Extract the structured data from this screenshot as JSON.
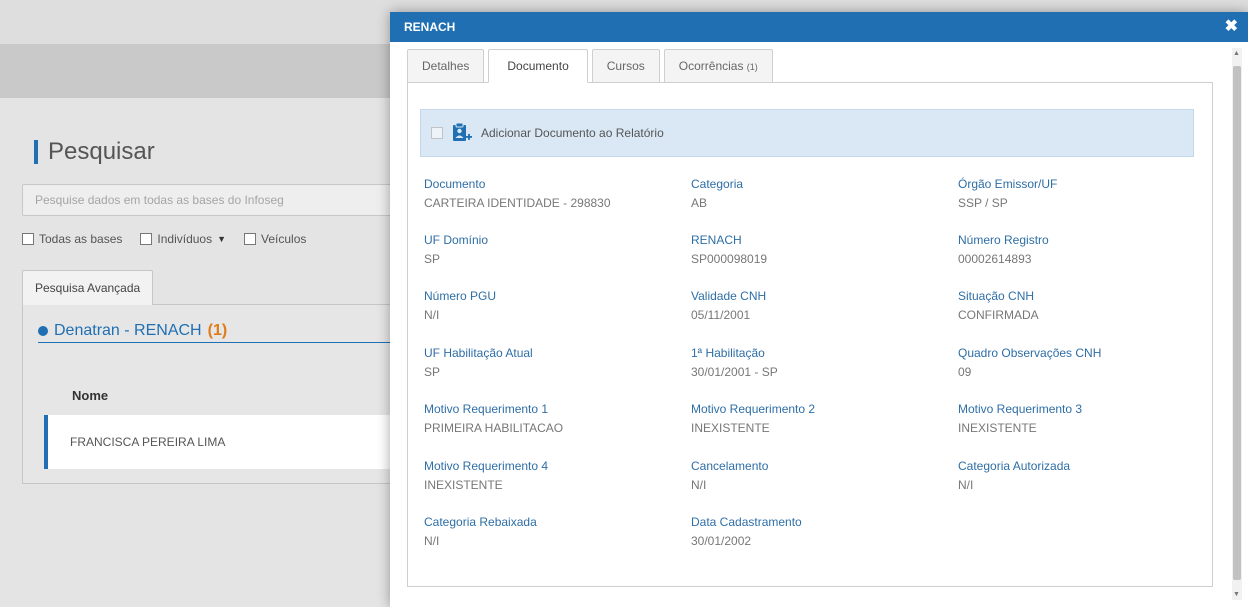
{
  "search": {
    "title": "Pesquisar",
    "placeholder": "Pesquise dados em todas as bases do Infoseg",
    "filters": [
      "Todas as bases",
      "Indivíduos",
      "Veículos"
    ],
    "advanced_tab": "Pesquisa Avançada"
  },
  "results": {
    "section_title": "Denatran - RENACH",
    "section_count": "(1)",
    "column_header": "Nome",
    "rows": [
      "FRANCISCA PEREIRA LIMA"
    ]
  },
  "modal": {
    "title": "RENACH",
    "tabs": [
      {
        "label": "Detalhes"
      },
      {
        "label": "Documento"
      },
      {
        "label": "Cursos"
      },
      {
        "label": "Ocorrências",
        "count": "(1)"
      }
    ],
    "add_to_report_label": "Adicionar Documento ao Relatório",
    "fields": [
      {
        "label": "Documento",
        "value": "CARTEIRA IDENTIDADE - 298830"
      },
      {
        "label": "Categoria",
        "value": "AB"
      },
      {
        "label": "Órgão Emissor/UF",
        "value": "SSP / SP"
      },
      {
        "label": "UF Domínio",
        "value": "SP"
      },
      {
        "label": "RENACH",
        "value": "SP000098019"
      },
      {
        "label": "Número Registro",
        "value": "00002614893"
      },
      {
        "label": "Número PGU",
        "value": "N/I"
      },
      {
        "label": "Validade CNH",
        "value": "05/11/2001"
      },
      {
        "label": "Situação CNH",
        "value": "CONFIRMADA"
      },
      {
        "label": "UF Habilitação Atual",
        "value": "SP"
      },
      {
        "label": "1ª Habilitação",
        "value": "30/01/2001 - SP"
      },
      {
        "label": "Quadro Observações CNH",
        "value": "09"
      },
      {
        "label": "Motivo Requerimento 1",
        "value": "PRIMEIRA HABILITACAO"
      },
      {
        "label": "Motivo Requerimento 2",
        "value": "INEXISTENTE"
      },
      {
        "label": "Motivo Requerimento 3",
        "value": "INEXISTENTE"
      },
      {
        "label": "Motivo Requerimento 4",
        "value": "INEXISTENTE"
      },
      {
        "label": "Cancelamento",
        "value": "N/I"
      },
      {
        "label": "Categoria Autorizada",
        "value": "N/I"
      },
      {
        "label": "Categoria Rebaixada",
        "value": "N/I"
      },
      {
        "label": "Data Cadastramento",
        "value": "30/01/2002"
      }
    ]
  },
  "colors": {
    "primary": "#1f6fb2",
    "accent_orange": "#e07b1b",
    "label_blue": "#2e6ea6",
    "add_bar_bg": "#d9e8f4"
  },
  "icons": {
    "close": "close-icon",
    "add_document": "add-document-icon",
    "dropdown": "chevron-down-icon"
  }
}
